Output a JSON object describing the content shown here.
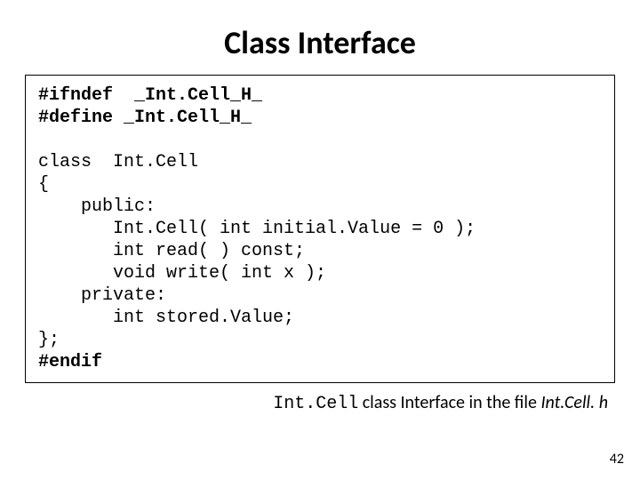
{
  "title": "Class Interface",
  "code": {
    "l1a": "#ifndef  ",
    "l1b": "_Int.Cell_H_",
    "l2a": "#define ",
    "l2b": "_Int.Cell_H_",
    "blank1": " ",
    "l3": "class  Int.Cell",
    "l4": "{",
    "l5": "    public:",
    "l6": "       Int.Cell( int initial.Value = 0 );",
    "l7": "       int read( ) const;",
    "l8": "       void write( int x );",
    "l9": "    private:",
    "l10": "       int stored.Value;",
    "l11": "};",
    "l12": "#endif"
  },
  "caption": {
    "p1": "Int.Cell",
    "p2": " class Interface in the file ",
    "p3": "Int.Cell. h"
  },
  "page_number": "42"
}
